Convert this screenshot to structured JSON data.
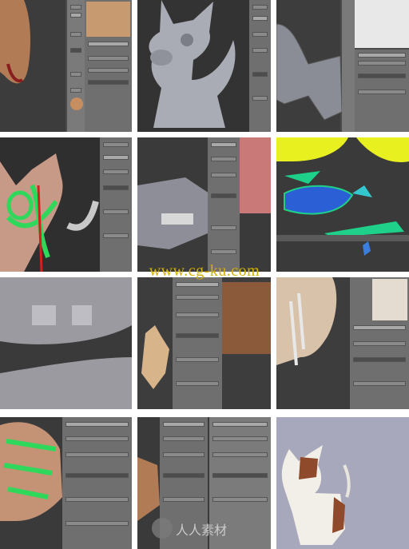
{
  "watermark": {
    "text": "www.cg-ku.com",
    "logo_text": "人人素材"
  },
  "tiles": [
    {
      "name": "tile-body-texture-paint",
      "desc": "textured body region with side panels"
    },
    {
      "name": "tile-head-sculpt",
      "desc": "gray sculpted dog head"
    },
    {
      "name": "tile-body-retopo",
      "desc": "body retopology wire"
    },
    {
      "name": "tile-weight-paint-head",
      "desc": "weight paint head with green seams"
    },
    {
      "name": "tile-teeth-sculpt",
      "desc": "teeth and jaw modeling with reference"
    },
    {
      "name": "tile-uv-layout",
      "desc": "UV layout colored islands"
    },
    {
      "name": "tile-teeth-closeup",
      "desc": "gray teeth closeup"
    },
    {
      "name": "tile-dog-reference",
      "desc": "dog model with photo reference"
    },
    {
      "name": "tile-leg-rig",
      "desc": "leg armature rig"
    },
    {
      "name": "tile-body-armature",
      "desc": "green bone armature over textured body"
    },
    {
      "name": "tile-fur-settings",
      "desc": "fur hair particle settings"
    },
    {
      "name": "tile-final-render",
      "desc": "final rendered dog"
    }
  ],
  "colors": {
    "ui_panel": "#6f6f6f",
    "viewport": "#3a3a3a",
    "watermark": "#d4b000",
    "bone_green": "#2fd85a",
    "uv_yellow": "#e8f020",
    "uv_blue": "#2a5fd6"
  }
}
